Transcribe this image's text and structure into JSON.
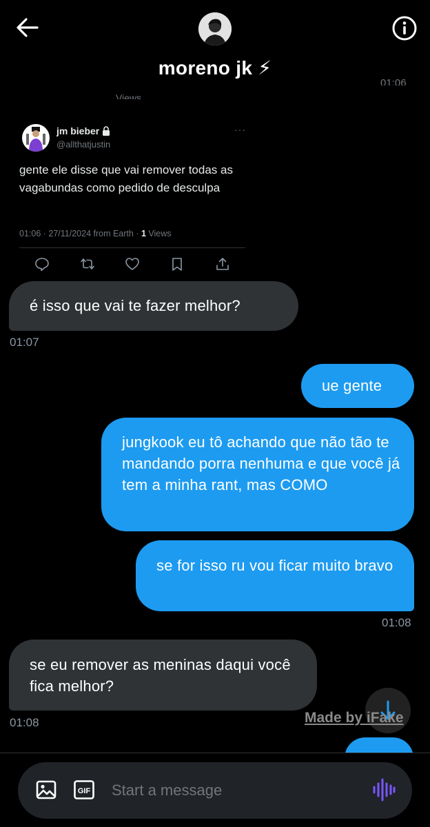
{
  "header": {
    "title": "moreno jk ⚡",
    "clipped_timestamp": "01:06",
    "clipped_text": "Views"
  },
  "tweet": {
    "name": "jm bieber",
    "handle": "@allthatjustin",
    "text": "gente ele disse que vai remover todas as vagabundas como pedido de desculpa",
    "meta_prefix": "01:06 · 27/11/2024 from Earth · ",
    "views_count": "1",
    "views_label": " Views",
    "more": "···"
  },
  "messages": [
    {
      "direction": "in",
      "text": "é isso que vai te fazer melhor?",
      "time": "01:07"
    },
    {
      "direction": "out",
      "text": "ue gente"
    },
    {
      "direction": "out",
      "text": "jungkook eu tô achando que não tão te mandando porra nenhuma e que você já tem a minha rant, mas COMO"
    },
    {
      "direction": "out",
      "text": "se for isso ru vou ficar muito bravo",
      "time": "01:08"
    },
    {
      "direction": "in",
      "text": "se eu remover as meninas daqui você fica melhor?",
      "time": "01:08"
    }
  ],
  "watermark": "Made by iFake",
  "compose": {
    "placeholder": "Start a message",
    "gif_label": "GIF"
  },
  "colors": {
    "background": "#000000",
    "incoming_bubble": "#2f3336",
    "outgoing_bubble": "#1d9bf0",
    "timestamp": "#8b98a5",
    "muted": "#71767b",
    "voice_accent": "#7856ff"
  }
}
